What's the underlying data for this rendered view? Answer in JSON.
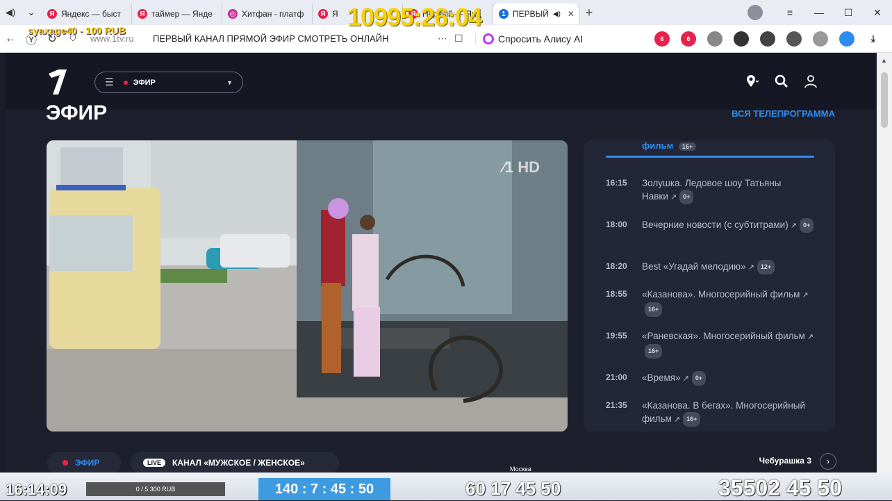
{
  "browser": {
    "tabs": [
      {
        "label": "Яндекс — быст",
        "fav": "Я",
        "color": "#e8224c"
      },
      {
        "label": "таймер — Янде",
        "fav": "Я",
        "color": "#e8224c"
      },
      {
        "label": "Хитфан - платф",
        "fav": "◎",
        "color": "#c22f9a"
      },
      {
        "label": "Я",
        "fav": "Я",
        "color": "#e8224c"
      },
      {
        "label": "Первый — Янд",
        "fav": "Я",
        "color": "#e8224c"
      }
    ],
    "active_tab": {
      "label": "ПЕРВЫЙ",
      "fav": "1"
    },
    "url_domain": "www.1tv.ru",
    "page_title": "ПЕРВЫЙ КАНАЛ ПРЯМОЙ ЭФИР СМОТРЕТЬ ОНЛАЙН",
    "alice_label": "Спросить Алису AI",
    "ext_badges": [
      "6",
      "6"
    ]
  },
  "overlay": {
    "timer": "10995:26:04",
    "donation": "syaxage40 - 100 RUB",
    "clock": "16:14:09",
    "goal": "0 / 5 300 RUB",
    "counter1": "140 : 7 : 45 : 50",
    "counter2": "60 17 45 50",
    "counter3": "35502 45 50",
    "city": "Москва"
  },
  "site": {
    "dropdown_label": "ЭФИР",
    "section_title": "ЭФИР",
    "all_program": "ВСЯ ТЕЛЕПРОГРАММА",
    "hd": "HD",
    "schedule": {
      "current_label": "фильм",
      "current_age": "16+",
      "items": [
        {
          "time": "16:15",
          "title": "Золушка. Ледовое шоу Татьяны Навки",
          "age": "0+"
        },
        {
          "time": "18:00",
          "title": "Вечерние новости (с субтитрами)",
          "age": "0+"
        },
        {
          "time": "18:20",
          "title": "Best «Угадай мелодию»",
          "age": "12+"
        },
        {
          "time": "18:55",
          "title": "«Казанова». Многосерийный фильм",
          "age": "16+"
        },
        {
          "time": "19:55",
          "title": "«Раневская». Многосерийный фильм",
          "age": "16+"
        },
        {
          "time": "21:00",
          "title": "«Время»",
          "age": "0+"
        },
        {
          "time": "21:35",
          "title": "«Казанова. В бегах». Многосерийный фильм",
          "age": "16+"
        }
      ]
    },
    "bottom": {
      "efir_label": "ЭФИР",
      "live_badge": "LIVE",
      "channel_label": "КАНАЛ «МУЖСКОЕ / ЖЕНСКОЕ»",
      "next_show": "Чебурашка 3"
    }
  }
}
